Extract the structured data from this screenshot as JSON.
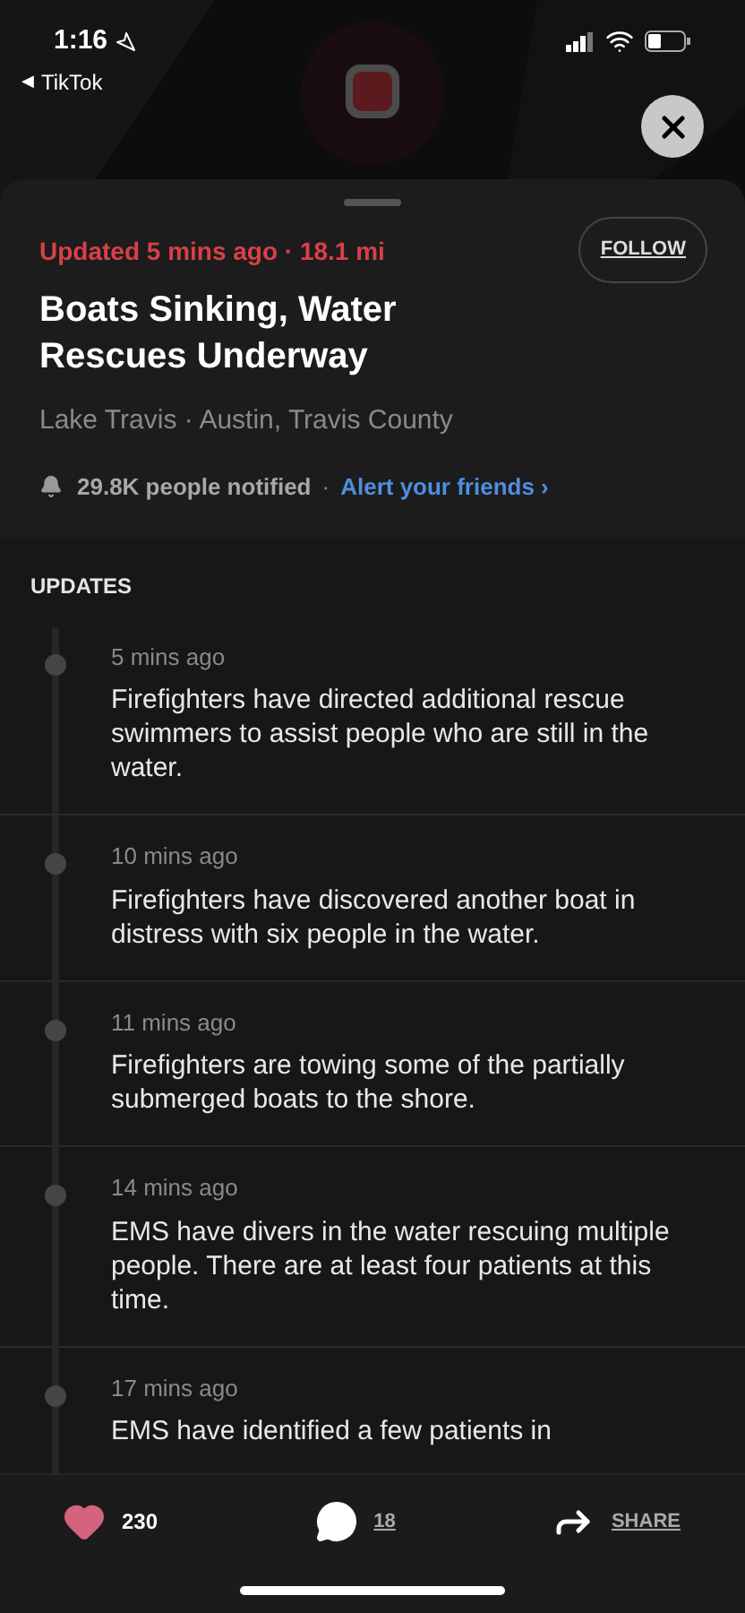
{
  "status_bar": {
    "time": "1:16",
    "back_arrow": "◀",
    "back_app": "TikTok"
  },
  "header": {
    "meta": "Updated 5 mins ago · 18.1 mi",
    "follow": "FOLLOW",
    "title": "Boats Sinking, Water Rescues Underway",
    "location": "Lake Travis · Austin, Travis County",
    "notified": "29.8K people notified",
    "separator": "·",
    "alert_link": "Alert your friends ›"
  },
  "updates": {
    "heading": "UPDATES",
    "items": [
      {
        "time": "5 mins ago",
        "text": "Firefighters have directed additional rescue swimmers to assist people who are still in the water."
      },
      {
        "time": "10 mins ago",
        "text": "Firefighters have discovered another boat in distress with six people in the water."
      },
      {
        "time": "11 mins ago",
        "text": "Firefighters are towing some of the partially submerged boats to the shore."
      },
      {
        "time": "14 mins ago",
        "text": "EMS have divers in the water rescuing multiple people. There are at least four patients at this time."
      },
      {
        "time": "17 mins ago",
        "text": "EMS have identified a few patients in"
      }
    ]
  },
  "footer": {
    "likes": "230",
    "comments": "18",
    "share": "SHARE"
  }
}
